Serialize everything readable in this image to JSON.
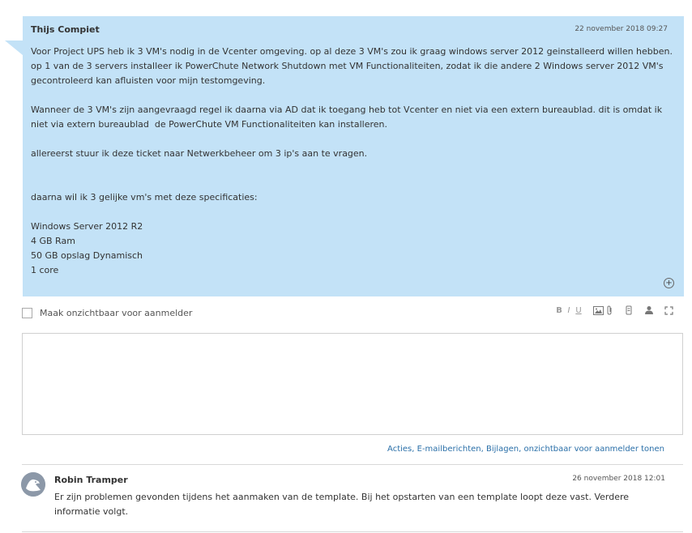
{
  "ticket_comment": {
    "author": "Thijs Compiet",
    "date": "22 november 2018 09:27",
    "body": "Voor Project UPS heb ik 3 VM's nodig in de Vcenter omgeving. op al deze 3 VM's zou ik graag windows server 2012 geinstalleerd willen hebben. op 1 van de 3 servers installeer ik PowerChute Network Shutdown met VM Functionaliteiten, zodat ik die andere 2 Windows server 2012 VM's gecontroleerd kan afluisten voor mijn testomgeving.\n\nWanneer de 3 VM's zijn aangevraagd regel ik daarna via AD dat ik toegang heb tot Vcenter en niet via een extern bureaublad. dit is omdat ik niet via extern bureaublad  de PowerChute VM Functionaliteiten kan installeren.\n\nallereerst stuur ik deze ticket naar Netwerkbeheer om 3 ip's aan te vragen.\n\n\ndaarna wil ik 3 gelijke vm's met deze specificaties:\n\nWindows Server 2012 R2\n4 GB Ram\n50 GB opslag Dynamisch\n1 core",
    "expand_icon": "plus-circle-icon"
  },
  "reply": {
    "hide_label": "Maak onzichtbaar voor aanmelder",
    "toolbar": {
      "bold": "B",
      "italic": "I",
      "underline": "U",
      "icons": [
        "image-icon",
        "attachment-icon",
        "template-icon",
        "user-icon",
        "fullscreen-icon"
      ]
    }
  },
  "filter_links": "Acties, E-mailberichten, Bijlagen, onzichtbaar voor aanmelder tonen",
  "comment2": {
    "author": "Robin Tramper",
    "date": "26 november 2018 12:01",
    "body": "Er zijn problemen gevonden tijdens het aanmaken van de template. Bij het opstarten van een template loopt deze vast. Verdere informatie volgt."
  },
  "colors": {
    "bubble": "#c3e2f7",
    "link": "#2a6fa8",
    "avatar": "#8c98a8"
  }
}
